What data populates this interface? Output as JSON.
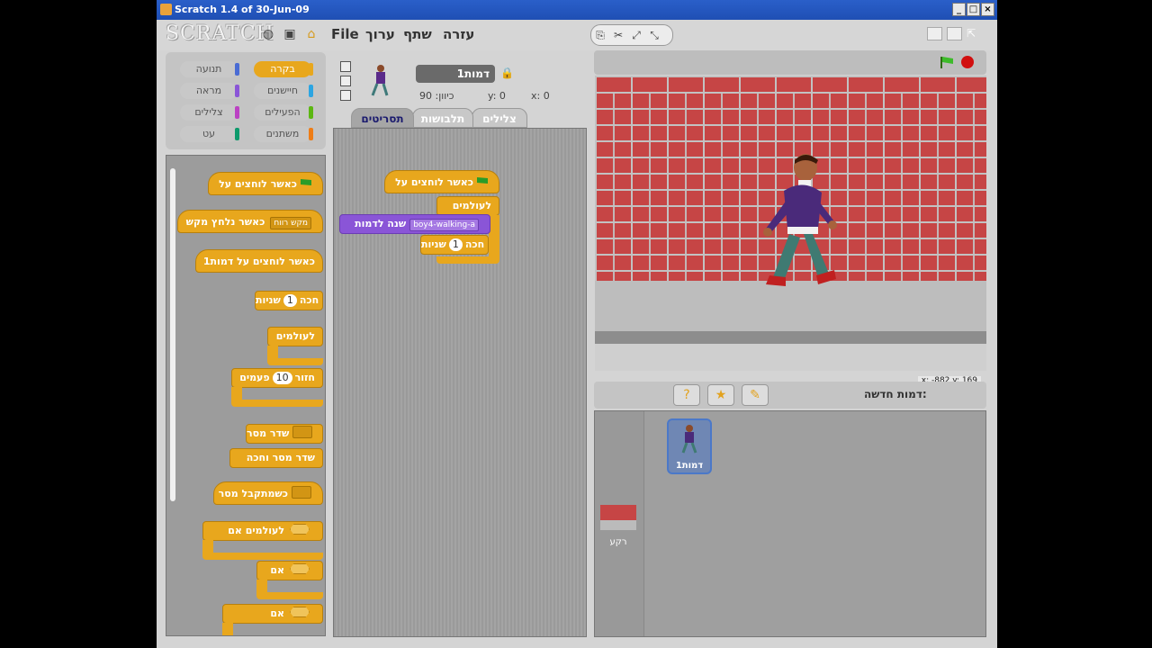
{
  "window": {
    "title": "Scratch 1.4 of 30-Jun-09"
  },
  "menu": {
    "logo": "SCRATCH",
    "file": "File",
    "edit": "ערוך",
    "share": "שתף",
    "help": "עזרה"
  },
  "categories": {
    "control": "בקרה",
    "motion": "תנועה",
    "sensing": "חיישנים",
    "looks": "מראה",
    "operators": "הפעילים",
    "sound": "צלילים",
    "variables": "משתנים",
    "pen": "עט"
  },
  "palette": {
    "when_flag": "כאשר לוחצים על",
    "when_key": "כאשר נלחץ מקש",
    "key_value": "מקש רווח",
    "when_sprite_clicked": "כאשר לוחצים על דמות1",
    "wait_prefix": "חכה",
    "wait_value": "1",
    "wait_suffix": "שניות",
    "forever": "לעולמים",
    "repeat": "חזור",
    "repeat_value": "10",
    "repeat_suffix": "פעמים",
    "broadcast": "שדר מסר",
    "broadcast_wait": "שדר מסר וחכה",
    "when_receive": "כשמתקבל מסר",
    "forever_if": "לעולמים אם",
    "if": "אם",
    "if2": "אם"
  },
  "sprite": {
    "name": "דמות1",
    "x_label": "x:",
    "x": "0",
    "y_label": "y:",
    "y": "0",
    "dir_label": "כיוון:",
    "direction": "90"
  },
  "tabs": {
    "scripts": "תסריטים",
    "costumes": "תלבושות",
    "sounds": "צלילים"
  },
  "script": {
    "hat": "כאשר לוחצים על",
    "forever": "לעולמים",
    "switch_costume": "שנה לדמות",
    "costume_value": "boy4-walking-a",
    "wait_prefix": "חכה",
    "wait_value": "1",
    "wait_suffix": "שניות"
  },
  "stage": {
    "mouse_xy": "x: -882  y: 169"
  },
  "new_sprite": {
    "label": "דמות חדשה:"
  },
  "corral": {
    "sprite_label": "דמות1",
    "stage_label": "רקע"
  }
}
